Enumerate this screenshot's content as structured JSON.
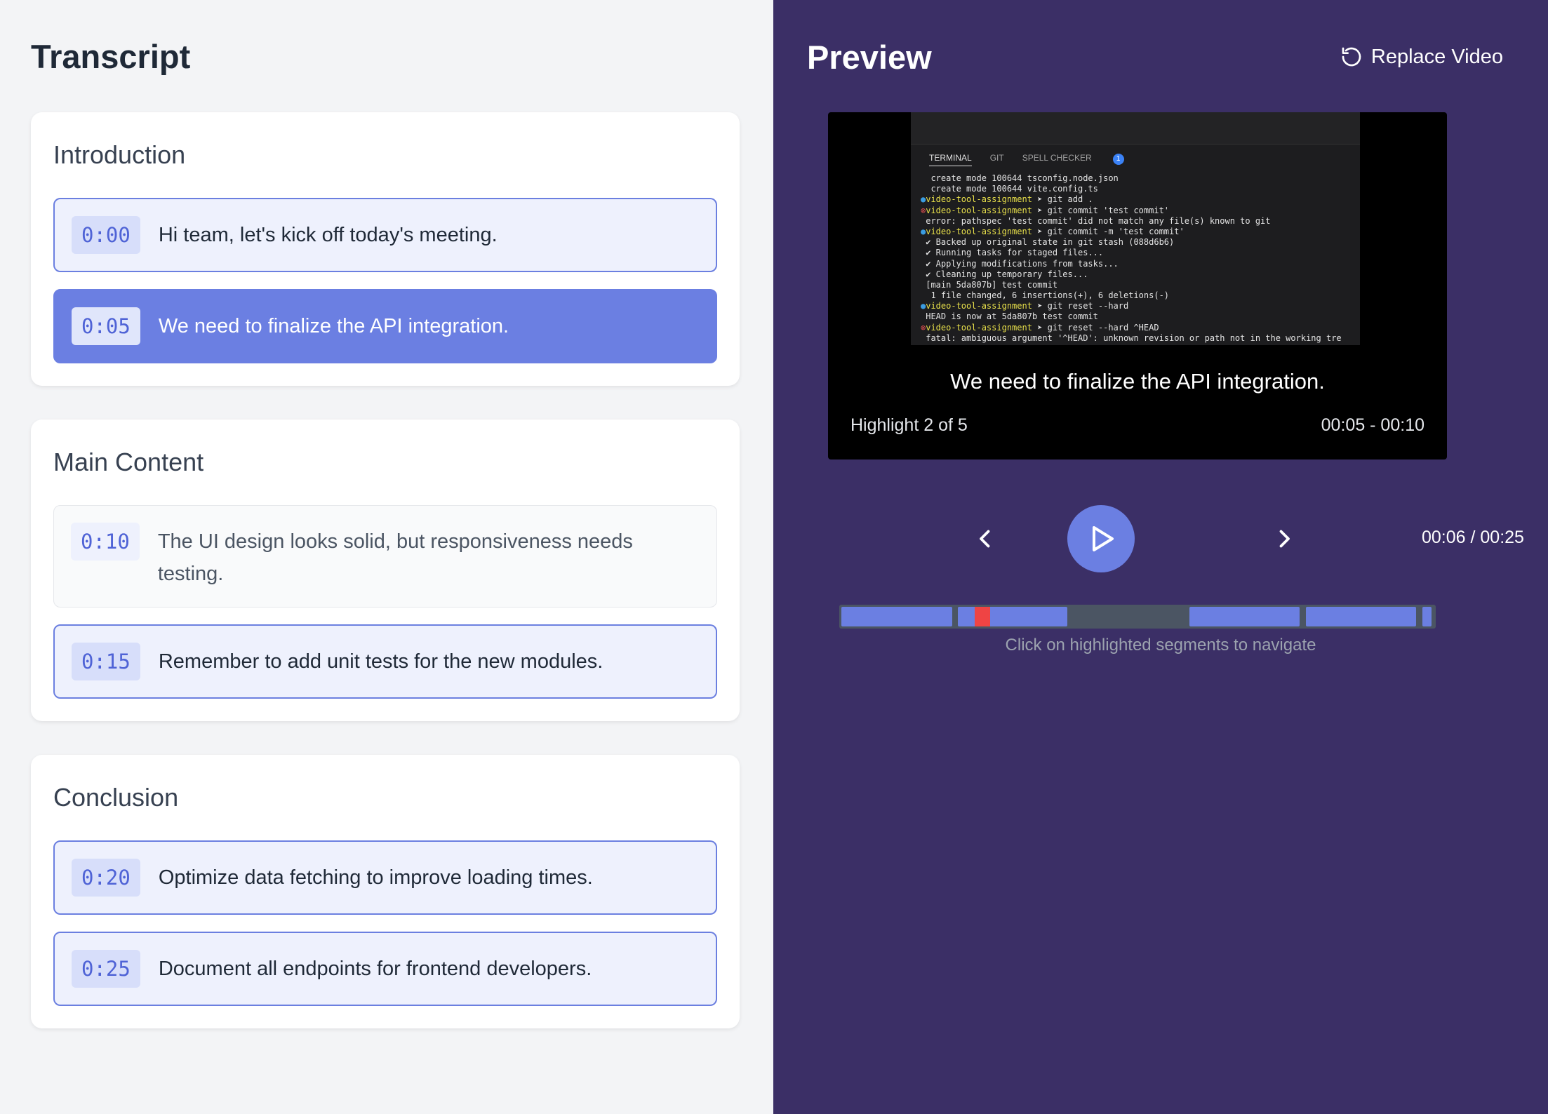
{
  "transcript": {
    "title": "Transcript",
    "sections": [
      {
        "title": "Introduction",
        "segments": [
          {
            "time": "0:00",
            "text": "Hi team, let's kick off today's meeting."
          },
          {
            "time": "0:05",
            "text": "We need to finalize the API integration."
          }
        ]
      },
      {
        "title": "Main Content",
        "segments": [
          {
            "time": "0:10",
            "text": "The UI design looks solid, but responsiveness needs testing."
          },
          {
            "time": "0:15",
            "text": "Remember to add unit tests for the new modules."
          }
        ]
      },
      {
        "title": "Conclusion",
        "segments": [
          {
            "time": "0:20",
            "text": "Optimize data fetching to improve loading times."
          },
          {
            "time": "0:25",
            "text": "Document all endpoints for frontend developers."
          }
        ]
      }
    ]
  },
  "preview": {
    "title": "Preview",
    "replace_label": "Replace Video",
    "caption": "We need to finalize the API integration.",
    "highlight_label": "Highlight 2 of 5",
    "highlight_range": "00:05 - 00:10",
    "time_display": "00:06 / 00:25",
    "timeline_hint": "Click on highlighted segments to navigate",
    "playhead_fraction": 0.24,
    "terminal": {
      "tabs": [
        "TERMINAL",
        "GIT",
        "SPELL CHECKER"
      ],
      "badge": "1",
      "lines": [
        {
          "marker": "",
          "prompt": "",
          "text": " create mode 100644 tsconfig.node.json"
        },
        {
          "marker": "",
          "prompt": "",
          "text": " create mode 100644 vite.config.ts"
        },
        {
          "marker": "blue",
          "prompt": "video-tool-assignment",
          "text": " ➤ git add ."
        },
        {
          "marker": "red",
          "prompt": "video-tool-assignment",
          "text": " ➤ git commit 'test commit'"
        },
        {
          "marker": "",
          "prompt": "",
          "text": "error: pathspec 'test commit' did not match any file(s) known to git"
        },
        {
          "marker": "blue",
          "prompt": "video-tool-assignment",
          "text": " ➤ git commit -m 'test commit'"
        },
        {
          "marker": "",
          "prompt": "",
          "text": "✔ Backed up original state in git stash (088d6b6)"
        },
        {
          "marker": "",
          "prompt": "",
          "text": "✔ Running tasks for staged files..."
        },
        {
          "marker": "",
          "prompt": "",
          "text": "✔ Applying modifications from tasks..."
        },
        {
          "marker": "",
          "prompt": "",
          "text": "✔ Cleaning up temporary files..."
        },
        {
          "marker": "",
          "prompt": "",
          "text": "[main 5da807b] test commit"
        },
        {
          "marker": "",
          "prompt": "",
          "text": " 1 file changed, 6 insertions(+), 6 deletions(-)"
        },
        {
          "marker": "blue",
          "prompt": "video-tool-assignment",
          "text": " ➤ git reset --hard"
        },
        {
          "marker": "",
          "prompt": "",
          "text": "HEAD is now at 5da807b test commit"
        },
        {
          "marker": "red",
          "prompt": "video-tool-assignment",
          "text": " ➤ git reset --hard ^HEAD"
        },
        {
          "marker": "",
          "prompt": "",
          "text": "fatal: ambiguous argument '^HEAD': unknown revision or path not in the working tre"
        }
      ]
    }
  },
  "colors": {
    "accent": "#6b7fe2",
    "right_bg": "#3b2f66",
    "left_bg": "#f3f4f6",
    "playhead": "#ef4444"
  },
  "icons": {
    "replace": "rotate-ccw-icon",
    "prev": "chevron-left-icon",
    "next": "chevron-right-icon",
    "play": "play-icon"
  }
}
